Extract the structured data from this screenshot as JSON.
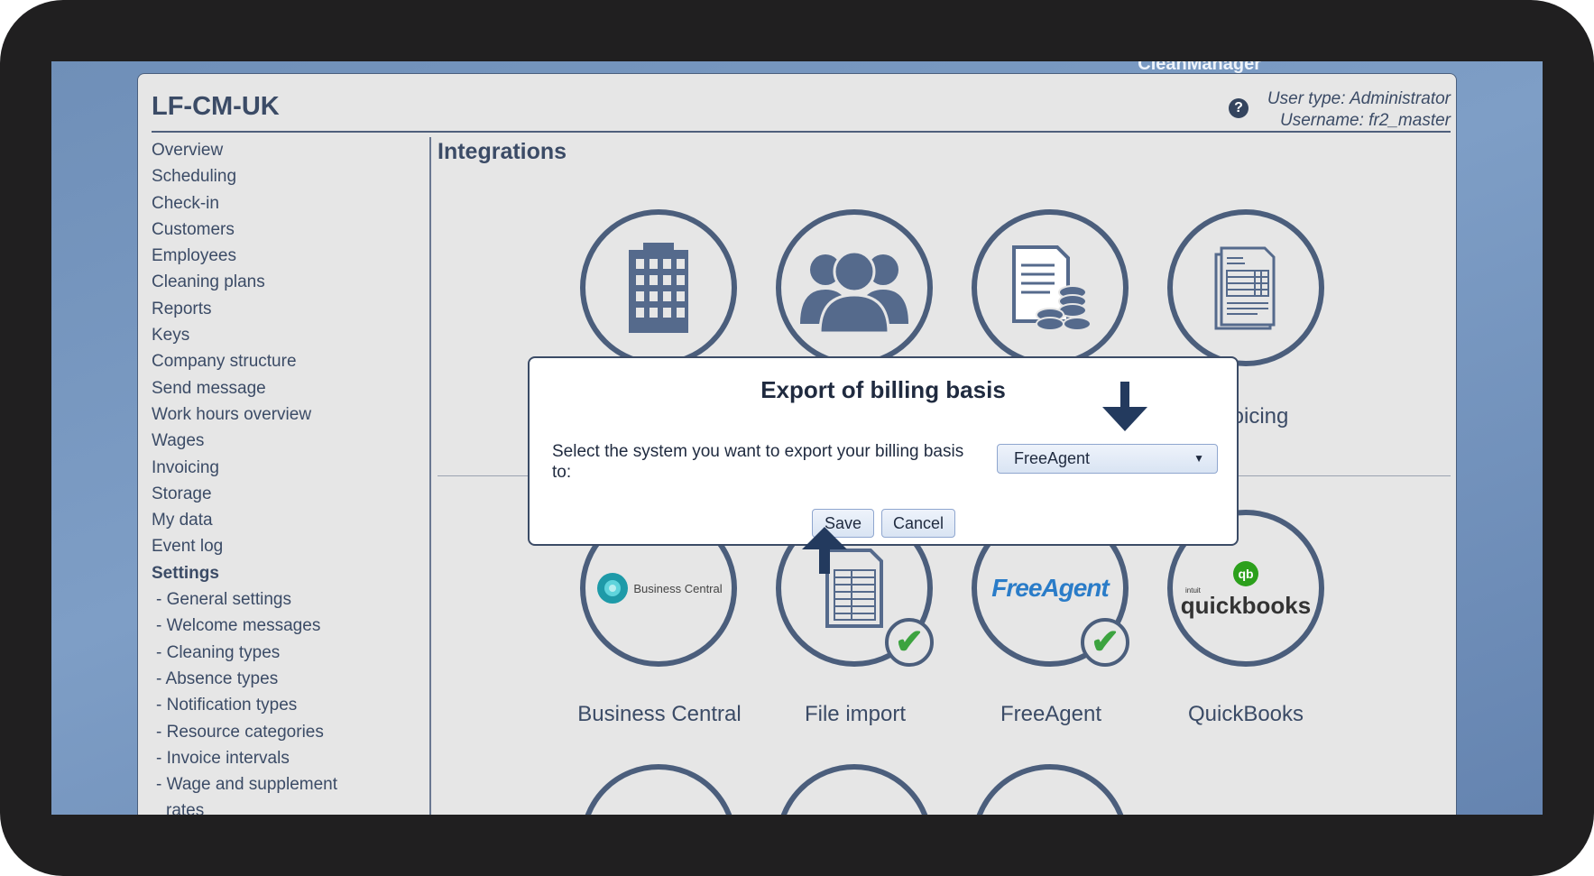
{
  "brand": "CleanManager",
  "header": {
    "title": "LF-CM-UK",
    "user_type": "User type: Administrator",
    "username": "Username: fr2_master"
  },
  "sidebar": {
    "items": [
      "Overview",
      "Scheduling",
      "Check-in",
      "Customers",
      "Employees",
      "Cleaning plans",
      "Reports",
      "Keys",
      "Company structure",
      "Send message",
      "Work hours overview",
      "Wages",
      "Invoicing",
      "Storage",
      "My data",
      "Event log"
    ],
    "settings_label": "Settings",
    "settings_items": [
      "- General settings",
      "- Welcome messages",
      "- Cleaning types",
      "- Absence types",
      "- Notification types",
      "- Resource categories",
      "- Invoice intervals",
      "- Wage and supplement",
      "rates"
    ]
  },
  "main": {
    "heading": "Integrations",
    "row1": [
      {
        "label": ""
      },
      {
        "label": ""
      },
      {
        "label": ""
      },
      {
        "label": "Invoicing"
      }
    ],
    "row2": [
      {
        "label": "Business Central",
        "logo": "Business Central",
        "connected": false
      },
      {
        "label": "File import",
        "connected": true
      },
      {
        "label": "FreeAgent",
        "logo": "FreeAgent",
        "connected": true
      },
      {
        "label": "QuickBooks",
        "logo": "quickbooks",
        "logo_small": "intuit",
        "connected": false
      }
    ]
  },
  "modal": {
    "title": "Export of billing basis",
    "prompt": "Select the system you want to export your billing basis to:",
    "selected": "FreeAgent",
    "save": "Save",
    "cancel": "Cancel"
  },
  "colors": {
    "accent": "#4b5e7c",
    "check": "#3ca33f",
    "freeagent": "#2a7cc8"
  }
}
